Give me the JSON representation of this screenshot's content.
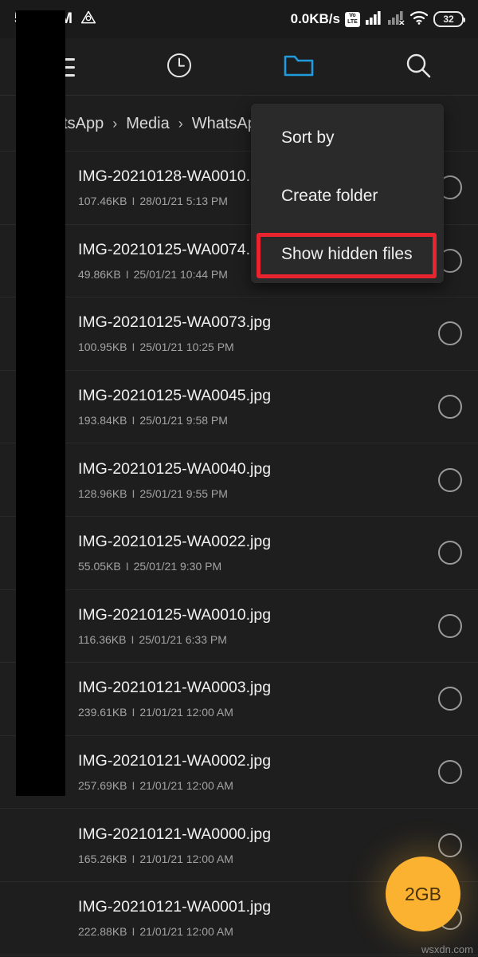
{
  "statusbar": {
    "time": "5:36 PM",
    "drive_icon": "triangle-drive-icon",
    "network_speed": "0.0KB/s",
    "volte_top": "Vo",
    "volte_bottom": "LTE",
    "signal_icon": "signal-bars-icon",
    "signal_off_icon": "signal-bars-disabled-icon",
    "wifi_icon": "wifi-icon",
    "battery_level": "32"
  },
  "toolbar": {
    "menu_icon": "hamburger-menu-icon",
    "recent_icon": "clock-icon",
    "folder_icon": "folder-icon",
    "search_icon": "search-icon",
    "active_color": "#1f9bde"
  },
  "breadcrumb": {
    "items": [
      "WhatsApp",
      "Media",
      "WhatsApp"
    ],
    "separator": "›"
  },
  "menu": {
    "items": [
      {
        "label": "Sort by"
      },
      {
        "label": "Create folder"
      },
      {
        "label": "Show hidden files"
      }
    ],
    "highlight_color": "#e8252f",
    "highlighted_index": 2
  },
  "files": [
    {
      "name": "IMG-20210128-WA0010.",
      "size": "107.46KB",
      "date": "28/01/21 5:13 PM"
    },
    {
      "name": "IMG-20210125-WA0074.",
      "size": "49.86KB",
      "date": "25/01/21 10:44 PM"
    },
    {
      "name": "IMG-20210125-WA0073.jpg",
      "size": "100.95KB",
      "date": "25/01/21 10:25 PM"
    },
    {
      "name": "IMG-20210125-WA0045.jpg",
      "size": "193.84KB",
      "date": "25/01/21 9:58 PM"
    },
    {
      "name": "IMG-20210125-WA0040.jpg",
      "size": "128.96KB",
      "date": "25/01/21 9:55 PM"
    },
    {
      "name": "IMG-20210125-WA0022.jpg",
      "size": "55.05KB",
      "date": "25/01/21 9:30 PM"
    },
    {
      "name": "IMG-20210125-WA0010.jpg",
      "size": "116.36KB",
      "date": "25/01/21 6:33 PM"
    },
    {
      "name": "IMG-20210121-WA0003.jpg",
      "size": "239.61KB",
      "date": "21/01/21 12:00 AM"
    },
    {
      "name": "IMG-20210121-WA0002.jpg",
      "size": "257.69KB",
      "date": "21/01/21 12:00 AM"
    },
    {
      "name": "IMG-20210121-WA0000.jpg",
      "size": "165.26KB",
      "date": "21/01/21 12:00 AM"
    },
    {
      "name": "IMG-20210121-WA0001.jpg",
      "size": "222.88KB",
      "date": "21/01/21 12:00 AM"
    }
  ],
  "meta_separator": "I",
  "fab": {
    "label": "2GB",
    "color": "#fbb231"
  },
  "watermark": {
    "text": "wsxdn.com"
  }
}
